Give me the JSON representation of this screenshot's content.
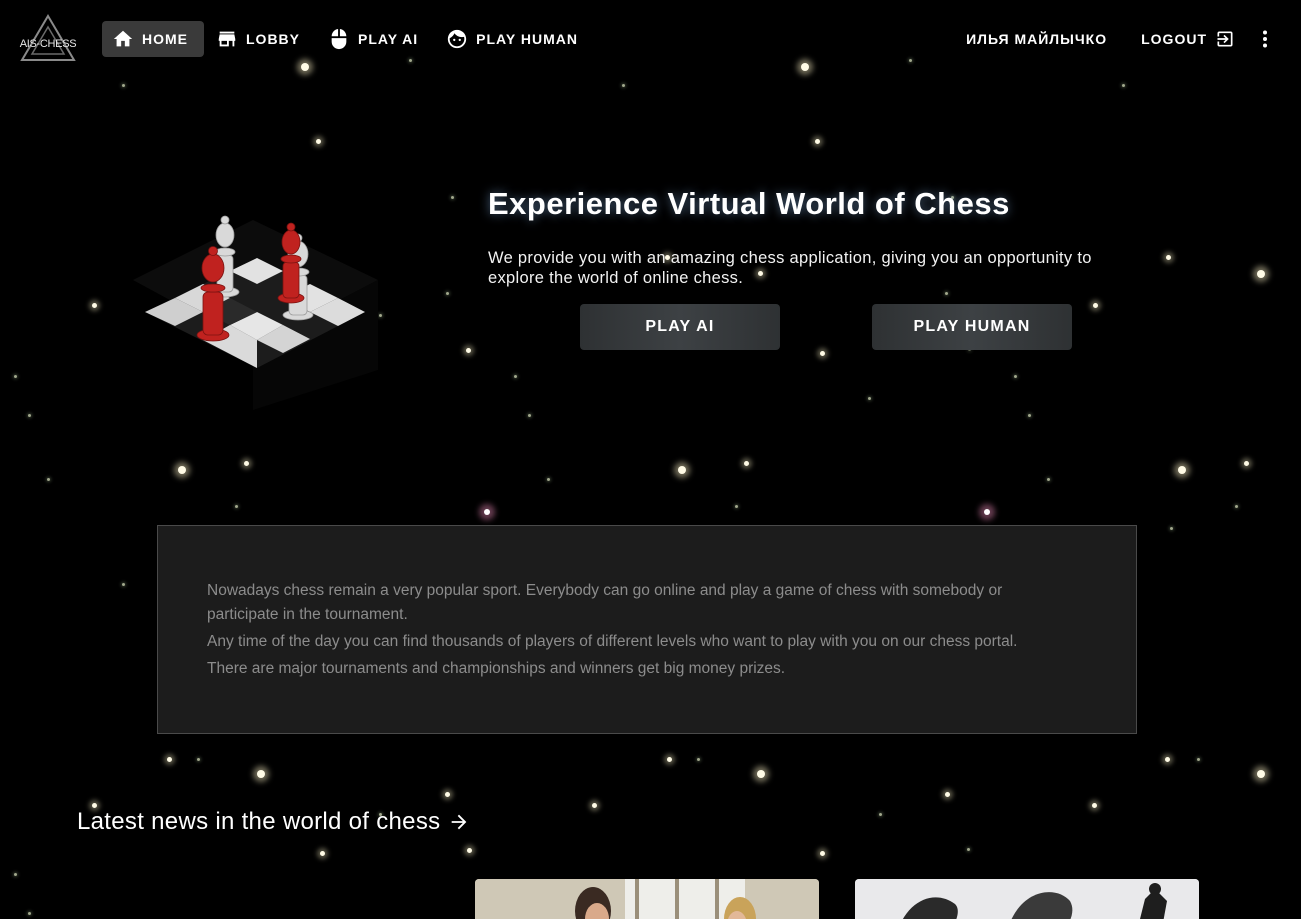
{
  "app": {
    "logo_text": "AIS-CHESS"
  },
  "nav": {
    "home": "HOME",
    "lobby": "LOBBY",
    "play_ai": "PLAY AI",
    "play_human": "PLAY HUMAN",
    "user_name": "ИЛЬЯ МАЙЛЫЧКО",
    "logout": "LOGOUT",
    "active": "home"
  },
  "icons": {
    "home": "home-icon",
    "lobby": "store-icon",
    "play_ai": "mouse-icon",
    "play_human": "face-icon",
    "logout": "logout-icon",
    "menu": "more-vertical-icon",
    "news_arrow": "arrow-right-icon"
  },
  "hero": {
    "title": "Experience Virtual World of Chess",
    "subtitle": "We provide you with an amazing chess application, giving you an opportunity to explore the world of online chess.",
    "play_ai_button": "PLAY AI",
    "play_human_button": "PLAY HUMAN"
  },
  "info": {
    "paragraphs": [
      "Nowadays chess remain a very popular sport. Everybody can go online and play a game of chess with somebody or participate in the tournament.",
      "Any time of the day you can find thousands of players of different levels who want to play with you on our chess portal.",
      "There are major tournaments and championships and winners get big money prizes."
    ]
  },
  "news": {
    "heading": "Latest news in the world of chess"
  },
  "colors": {
    "background": "#000000",
    "nav_active": "#3a3a3a",
    "button": "#3d4144",
    "card": "#1e1e1e",
    "card_text": "#8c8c8c",
    "piece_red": "#c0221f",
    "piece_white": "#d9d9d9"
  }
}
